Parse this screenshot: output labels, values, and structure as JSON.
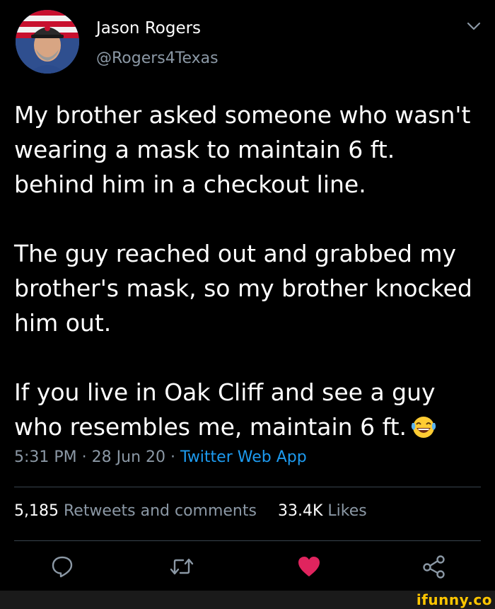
{
  "author": {
    "name": "Jason Rogers",
    "handle": "@Rogers4Texas"
  },
  "tweet": {
    "paragraphs": [
      "My brother asked someone who wasn't wearing a mask to maintain 6 ft. behind him in a checkout line.",
      "The guy reached out and grabbed my brother's mask, so my brother knocked him out.",
      "If you live in Oak Cliff and see a guy who resembles me, maintain 6 ft."
    ],
    "emoji": "face-with-tears-of-joy"
  },
  "meta": {
    "time": "5:31 PM",
    "separator": "·",
    "date": "28 Jun 20",
    "app": "Twitter Web App"
  },
  "stats": {
    "retweets_count": "5,185",
    "retweets_label": "Retweets and comments",
    "likes_count": "33.4K",
    "likes_label": "Likes"
  },
  "actions": [
    "reply-icon",
    "retweet-icon",
    "like-icon",
    "share-icon"
  ],
  "colors": {
    "background": "#000000",
    "secondary_text": "#8b98a5",
    "link": "#1d9bf0",
    "like": "#e0245e",
    "watermark": "#ffc600"
  },
  "watermark": "ifunny.co"
}
